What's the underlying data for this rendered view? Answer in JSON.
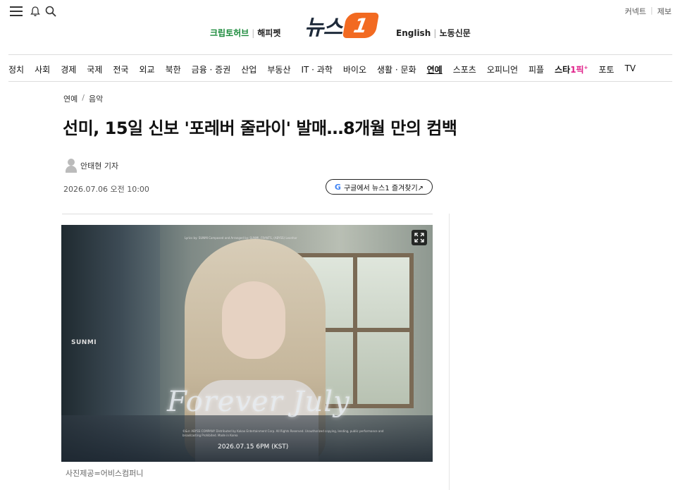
{
  "header": {
    "top_right": [
      "커넥트",
      "제보"
    ],
    "logo_text": "뉴스",
    "logo_badge": "1",
    "links_left": [
      "크립토허브",
      "해피펫"
    ],
    "links_right": [
      "English",
      "노동신문"
    ]
  },
  "gnb": {
    "items": [
      "정치",
      "사회",
      "경제",
      "국제",
      "전국",
      "외교",
      "북한",
      "금융 · 증권",
      "산업",
      "부동산",
      "IT · 과학",
      "바이오",
      "생활 · 문화",
      "연예",
      "스포츠",
      "오피니언",
      "피플"
    ],
    "star_label_a": "스타",
    "star_label_b": "1픽",
    "star_label_c": "+",
    "tail_items": [
      "포토",
      "TV"
    ],
    "active": "연예"
  },
  "article": {
    "breadcrumb": [
      "연예",
      "음악"
    ],
    "title": "선미, 15일 신보 '포레버 줄라이' 발매…8개월 만의 컴백",
    "reporter": "안태현 기자",
    "date": "2026.07.06 오전 10:00",
    "google_button": "구글에서 뉴스1 즐겨찾기↗",
    "google_logo": "G",
    "photo": {
      "top_credit": "Lyrics by: SUNMI   Composed and Arranged by: SUNMI, FRANTS, (ABYSS) Leonhar",
      "artist_mark": "SUNMI",
      "album_title": "Forever July",
      "copyright": "©&℗ ABYSS COMPANY Distributed by Kakao Entertainment Corp. All Rights Reserved. Unauthorized copying, lending, public performance and broadcasting Prohibited. Made in Korea",
      "release_text": "2026.07.15 6PM (KST)"
    },
    "caption": "사진제공=어비스컴퍼니"
  }
}
